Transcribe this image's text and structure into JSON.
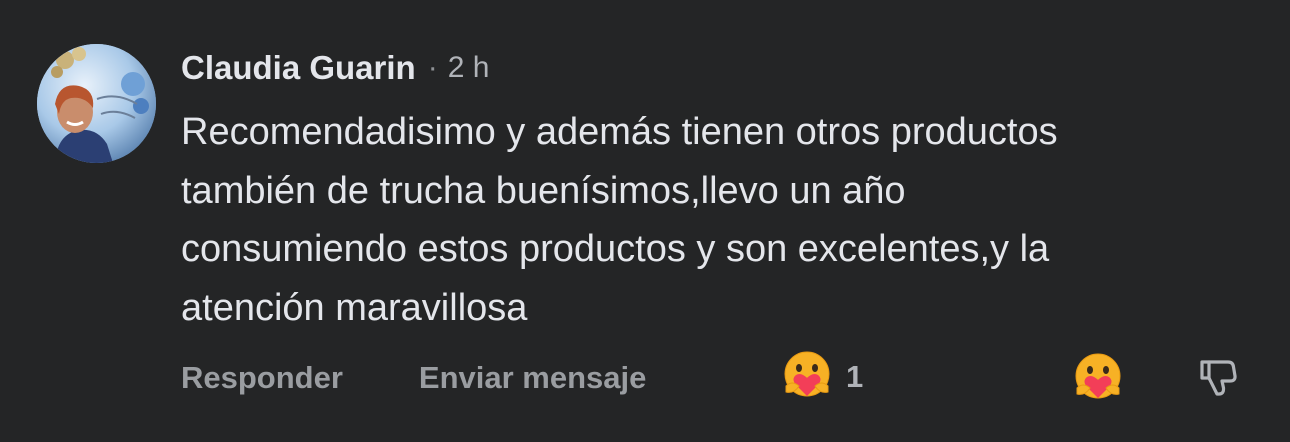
{
  "comment": {
    "author": "Claudia Guarin",
    "separator": "·",
    "time": "2 h",
    "body_lines": [
      "Recomendadisimo y además tienen otros productos",
      "también de trucha buenísimos,llevo un año",
      "consumiendo estos productos y son excelentes,y la",
      "atención maravillosa"
    ]
  },
  "actions": {
    "reply_label": "Responder",
    "message_label": "Enviar mensaje"
  },
  "reactions": {
    "summary_icon": "care-reaction-icon",
    "count": "1",
    "react_icon": "care-reaction-icon",
    "dislike_icon": "thumbs-down-icon"
  },
  "colors": {
    "background": "#242526",
    "primary_text": "#e4e6eb",
    "secondary_text": "#b0b3b8",
    "action_text": "#9a9da1",
    "care_face": "#f7b125",
    "care_heart": "#f33e58"
  }
}
